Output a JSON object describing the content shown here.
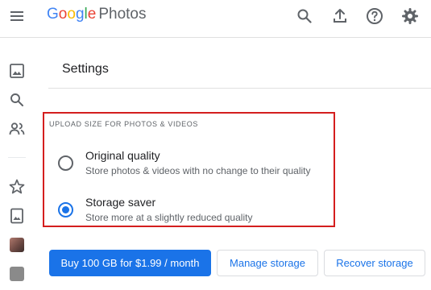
{
  "header": {
    "logo_letters": [
      {
        "char": "G",
        "color": "#4285F4"
      },
      {
        "char": "o",
        "color": "#EA4335"
      },
      {
        "char": "o",
        "color": "#FBBC05"
      },
      {
        "char": "g",
        "color": "#4285F4"
      },
      {
        "char": "l",
        "color": "#34A853"
      },
      {
        "char": "e",
        "color": "#EA4335"
      }
    ],
    "product": "Photos",
    "icons": [
      "menu-icon",
      "search-icon",
      "upload-icon",
      "help-icon",
      "settings-icon"
    ]
  },
  "sidebar": {
    "icons": [
      "photos-icon",
      "search-icon",
      "sharing-icon",
      "favorites-icon",
      "albums-icon"
    ]
  },
  "main": {
    "title": "Settings",
    "upload_section": {
      "label": "UPLOAD SIZE FOR PHOTOS & VIDEOS",
      "options": [
        {
          "title": "Original quality",
          "description": "Store photos & videos with no change to their quality",
          "selected": false
        },
        {
          "title": "Storage saver",
          "description": "Store more at a slightly reduced quality",
          "selected": true
        }
      ]
    },
    "buttons": {
      "buy": "Buy 100 GB for $1.99 / month",
      "manage": "Manage storage",
      "recover": "Recover storage"
    }
  },
  "colors": {
    "accent": "#1a73e8",
    "highlight_border": "#d41e1e",
    "icon_gray": "#5f6368"
  }
}
